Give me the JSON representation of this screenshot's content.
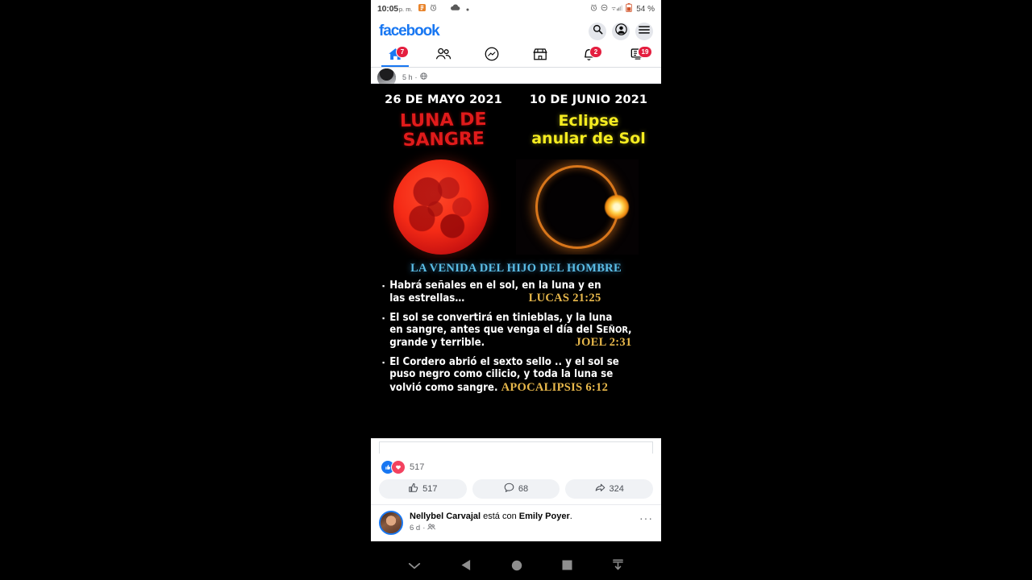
{
  "statusbar": {
    "time": "10:05",
    "ampm": "p. m.",
    "battery_pct": "54 %",
    "icons": [
      "app-notification-icon",
      "alarm-icon",
      "cloud-icon",
      "dot-icon",
      "alarm-icon",
      "do-not-disturb-icon",
      "wifi-signal-icon",
      "battery-icon"
    ]
  },
  "header": {
    "logo": "facebook",
    "buttons": [
      {
        "name": "search-icon",
        "label": "Buscar"
      },
      {
        "name": "account-icon",
        "label": "Cuenta"
      },
      {
        "name": "menu-icon",
        "label": "Menú"
      }
    ]
  },
  "tabs": [
    {
      "name": "tab-home",
      "icon": "home-icon",
      "badge": "7",
      "active": true
    },
    {
      "name": "tab-friends",
      "icon": "friends-icon",
      "badge": "",
      "active": false
    },
    {
      "name": "tab-messenger",
      "icon": "messenger-icon",
      "badge": "",
      "active": false
    },
    {
      "name": "tab-marketplace",
      "icon": "marketplace-icon",
      "badge": "",
      "active": false
    },
    {
      "name": "tab-notifications",
      "icon": "bell-icon",
      "badge": "2",
      "active": false
    },
    {
      "name": "tab-menu",
      "icon": "screen-menu-icon",
      "badge": "19",
      "active": false
    }
  ],
  "top_post_sliver": {
    "timestamp": "5 h",
    "separator": "·",
    "audience_icon": "globe-icon"
  },
  "graphic_post": {
    "left": {
      "date": "26 DE MAYO 2021",
      "title_line1": "LUNA DE",
      "title_line2": "SANGRE",
      "image": "blood-moon-image"
    },
    "right": {
      "date": "10 DE JUNIO 2021",
      "title_line1": "Eclipse",
      "title_line2": "anular de Sol",
      "image": "annular-solar-eclipse-image"
    },
    "banner": "LA VENIDA DEL HIJO DEL HOMBRE",
    "verses": [
      {
        "text_line1": "Habrá señales en el sol, en la luna y en",
        "text_line2": "las estrellas…",
        "reference": "LUCAS 21:25"
      },
      {
        "text_line1": "El sol se convertirá en tinieblas, y la luna",
        "text_line2": "en sangre, antes que venga el día del S",
        "text_line2_smallcaps": "EÑOR",
        "text_line2_end": ",",
        "text_line3": "grande y terrible.",
        "reference": "JOEL 2:31"
      },
      {
        "text_line1": "El Cordero abrió el sexto sello .. y el sol se",
        "text_line2": "puso negro como cilicio, y toda la luna se",
        "text_line3": "volvió como sangre.",
        "reference": "APOCALIPSIS 6:12"
      }
    ],
    "colors": {
      "background": "#000000",
      "red_title": "#e01b1b",
      "yellow_title": "#f5ec20",
      "banner_blue": "#5bbde6",
      "reference_gold": "#e8b84b"
    }
  },
  "reactions": {
    "icons": [
      "like-reaction-icon",
      "love-reaction-icon"
    ],
    "count": "517"
  },
  "actions": [
    {
      "name": "like-button",
      "icon": "thumbs-up-icon",
      "label": "517"
    },
    {
      "name": "comment-button",
      "icon": "comment-icon",
      "label": "68"
    },
    {
      "name": "share-button",
      "icon": "share-icon",
      "label": "324"
    }
  ],
  "next_post": {
    "author": "Nellybel Carvajal",
    "connector": " está con ",
    "tagged": "Emily Poyer",
    "period": ".",
    "timestamp": "6 d",
    "separator": "·",
    "audience_icon": "friends-icon",
    "menu": "···"
  },
  "android_nav": [
    {
      "name": "hide-keyboard-icon",
      "glyph": "chevron-down"
    },
    {
      "name": "back-icon",
      "glyph": "triangle-left"
    },
    {
      "name": "home-icon",
      "glyph": "circle"
    },
    {
      "name": "recents-icon",
      "glyph": "square"
    },
    {
      "name": "collapse-icon",
      "glyph": "download-arrow"
    }
  ]
}
